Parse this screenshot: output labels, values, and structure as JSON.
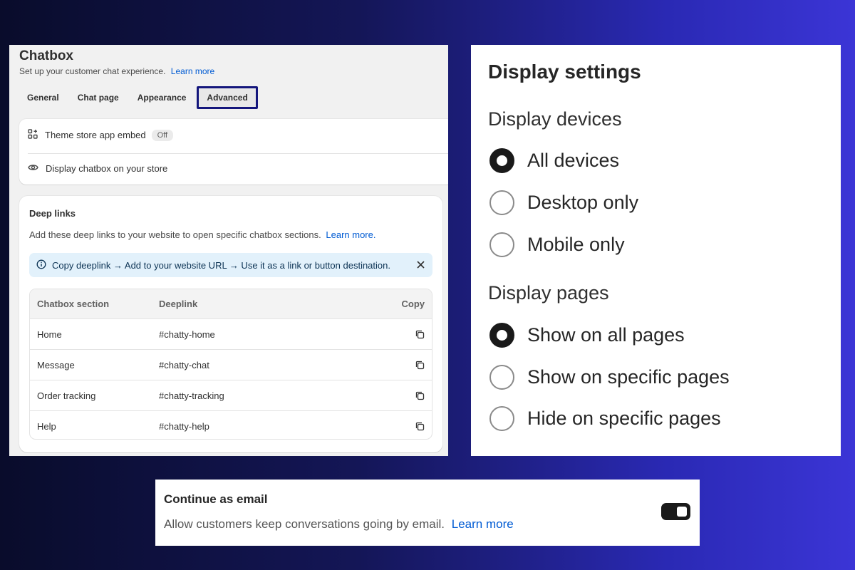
{
  "chatbox": {
    "title": "Chatbox",
    "subtitle": "Set up your customer chat experience.",
    "learn_more": "Learn more",
    "tabs": [
      {
        "label": "General"
      },
      {
        "label": "Chat page"
      },
      {
        "label": "Appearance"
      },
      {
        "label": "Advanced",
        "active": true
      }
    ],
    "theme_embed": {
      "label": "Theme store app embed",
      "status": "Off"
    },
    "display_row": {
      "label": "Display chatbox on your store"
    },
    "deep_links": {
      "title": "Deep links",
      "description": "Add these deep links to your website to open specific chatbox sections.",
      "learn_more": "Learn more.",
      "banner": "Copy deeplink → Add to your website URL → Use it as a link or button destination.",
      "columns": [
        "Chatbox section",
        "Deeplink",
        "Copy"
      ],
      "rows": [
        {
          "section": "Home",
          "link": "#chatty-home"
        },
        {
          "section": "Message",
          "link": "#chatty-chat"
        },
        {
          "section": "Order tracking",
          "link": "#chatty-tracking"
        },
        {
          "section": "Help",
          "link": "#chatty-help"
        }
      ]
    }
  },
  "display_settings": {
    "title": "Display settings",
    "devices": {
      "title": "Display devices",
      "options": [
        {
          "label": "All devices",
          "checked": true
        },
        {
          "label": "Desktop only",
          "checked": false
        },
        {
          "label": "Mobile only",
          "checked": false
        }
      ]
    },
    "pages": {
      "title": "Display pages",
      "options": [
        {
          "label": "Show on all pages",
          "checked": true
        },
        {
          "label": "Show on specific pages",
          "checked": false
        },
        {
          "label": "Hide on specific pages",
          "checked": false
        }
      ]
    }
  },
  "continue_email": {
    "title": "Continue as email",
    "description": "Allow customers keep conversations going by email.",
    "learn_more": "Learn more",
    "enabled": true
  },
  "colors": {
    "accent_link": "#005bd3",
    "active_tab_border": "#14167c",
    "banner_bg": "#e2f1fb"
  },
  "icons": {
    "embed": "app-embed-icon",
    "display": "eye-icon",
    "info": "info-icon",
    "close": "close-icon",
    "copy": "copy-icon"
  }
}
